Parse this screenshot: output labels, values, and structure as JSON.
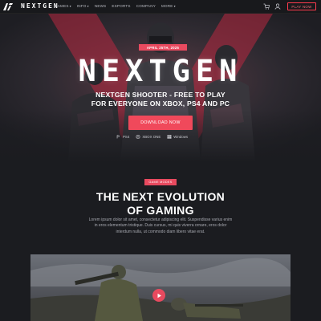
{
  "nav": {
    "brand": "NEXTGEN",
    "menu": [
      {
        "label": "GAMES",
        "has_dropdown": true
      },
      {
        "label": "INFO",
        "has_dropdown": true
      },
      {
        "label": "NEWS",
        "has_dropdown": false
      },
      {
        "label": "ESPORTS",
        "has_dropdown": false
      },
      {
        "label": "COMPANY",
        "has_dropdown": false
      },
      {
        "label": "MORE",
        "has_dropdown": true
      }
    ],
    "caret": "▾",
    "cta": "PLAY NOW",
    "icons": [
      "logo-icon",
      "cart-icon",
      "user-icon"
    ]
  },
  "hero": {
    "date_badge": "APRIL 25TH, 2025",
    "title": "NEXTGEN",
    "subtitle": "NEXTGEN SHOOTER - FREE TO PLAY FOR EVERYONE ON XBOX, PS4 AND PC",
    "download_button": "DOWNLOAD NOW",
    "platforms": [
      {
        "label": "PS4",
        "icon": "playstation-icon"
      },
      {
        "label": "XBOX ONE",
        "icon": "xbox-icon"
      },
      {
        "label": "Windows",
        "icon": "windows-icon"
      }
    ]
  },
  "section": {
    "badge": "GAME MODES",
    "title_line1": "THE NEXT EVOLUTION",
    "title_line2": "OF GAMING",
    "body": "Lorem ipsum dolor sit amet, consectetur adipiscing elit. Suspendisse varius enim in eros elementum tristique. Duis cursus, mi quis viverra ornare, eros dolor interdum nulla, ut commodo diam libero vitae erat."
  },
  "media": {
    "play_icon": "play-icon"
  },
  "colors": {
    "accent": "#e84a5f",
    "background": "#1b1c20",
    "nav_bg": "#18191c"
  }
}
